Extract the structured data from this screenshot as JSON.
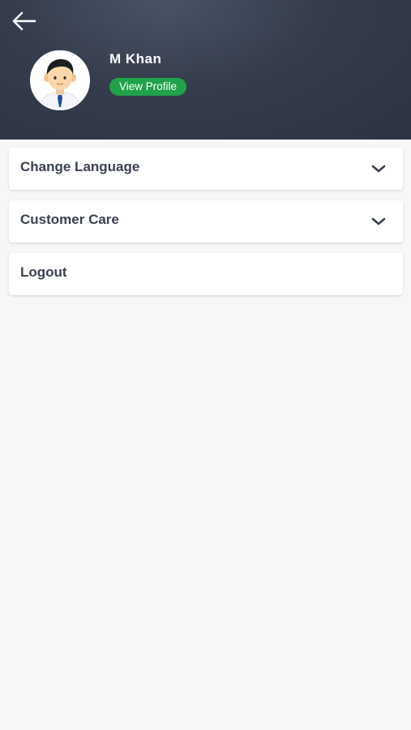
{
  "header": {
    "back_icon": "arrow-left-icon",
    "avatar_icon": "user-avatar-icon",
    "user_name": "M Khan",
    "view_profile_label": "View Profile",
    "colors": {
      "background": "#353d4d",
      "badge": "#1fa24a",
      "text": "#ffffff"
    }
  },
  "menu": {
    "items": [
      {
        "label": "Change Language",
        "icon": "chevron-down-icon"
      },
      {
        "label": "Customer Care",
        "icon": "chevron-down-icon"
      },
      {
        "label": "Logout"
      }
    ],
    "text_color": "#3a4150"
  }
}
